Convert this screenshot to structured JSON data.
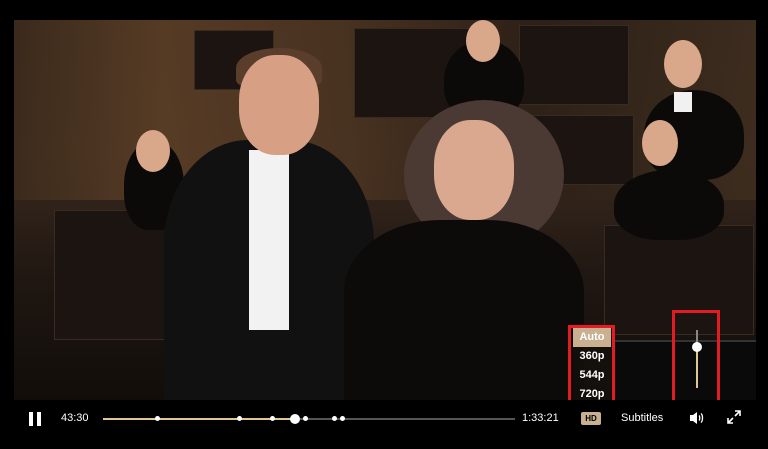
{
  "player": {
    "quality_menu": {
      "options": [
        "Auto",
        "360p",
        "544p",
        "720p"
      ],
      "selected": "Auto"
    },
    "controls": {
      "current_time": "43:30",
      "duration": "1:33:21",
      "progress_fraction": 0.466,
      "chapter_markers": [
        0.13,
        0.33,
        0.41,
        0.49,
        0.56,
        0.58
      ],
      "hd_label": "HD",
      "subtitles_label": "Subtitles",
      "volume_level": 0.7
    },
    "icons": {
      "pause": "pause-icon",
      "volume": "volume-icon",
      "fullscreen": "fullscreen-icon"
    },
    "colors": {
      "accent": "#e0c690",
      "highlight": "#e31b23"
    }
  }
}
